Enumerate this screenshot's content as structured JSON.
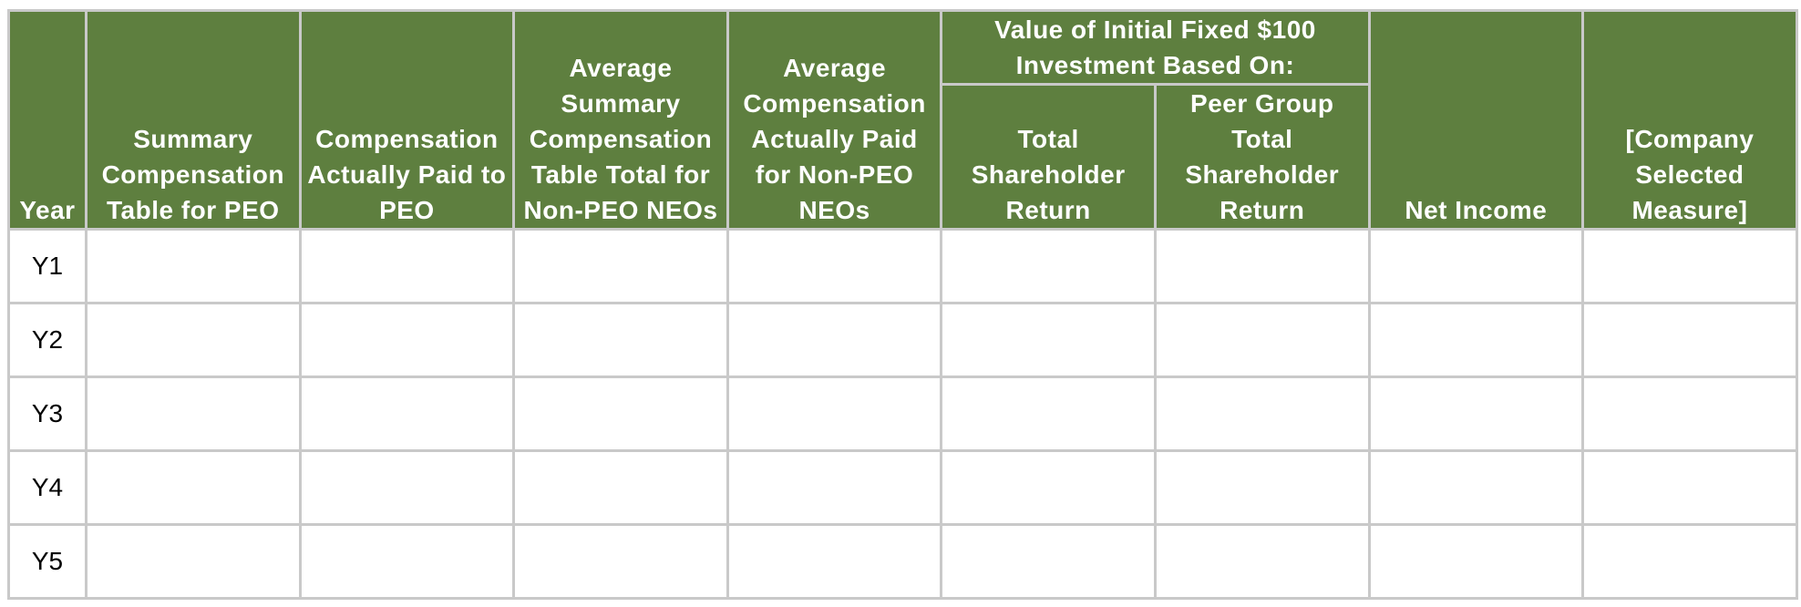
{
  "table": {
    "header_color": "#5e7f3f",
    "columns": {
      "year": "Year",
      "sct_peo": "Summary Compensation Table for PEO",
      "cap_peo": "Compensation Actually Paid to PEO",
      "avg_sct_neo": "Average Summary Compensation Table Total for Non-PEO NEOs",
      "avg_cap_neo": "Average Compensation Actually Paid for Non-PEO NEOs",
      "investment_group": "Value of Initial Fixed $100 Investment Based On:",
      "tsr": "Total Shareholder Return",
      "peer_tsr": "Peer Group Total Shareholder Return",
      "net_income": "Net Income",
      "company_measure": "[Company Selected Measure]"
    },
    "rows": [
      {
        "year": "Y1",
        "sct_peo": "",
        "cap_peo": "",
        "avg_sct_neo": "",
        "avg_cap_neo": "",
        "tsr": "",
        "peer_tsr": "",
        "net_income": "",
        "company_measure": ""
      },
      {
        "year": "Y2",
        "sct_peo": "",
        "cap_peo": "",
        "avg_sct_neo": "",
        "avg_cap_neo": "",
        "tsr": "",
        "peer_tsr": "",
        "net_income": "",
        "company_measure": ""
      },
      {
        "year": "Y3",
        "sct_peo": "",
        "cap_peo": "",
        "avg_sct_neo": "",
        "avg_cap_neo": "",
        "tsr": "",
        "peer_tsr": "",
        "net_income": "",
        "company_measure": ""
      },
      {
        "year": "Y4",
        "sct_peo": "",
        "cap_peo": "",
        "avg_sct_neo": "",
        "avg_cap_neo": "",
        "tsr": "",
        "peer_tsr": "",
        "net_income": "",
        "company_measure": ""
      },
      {
        "year": "Y5",
        "sct_peo": "",
        "cap_peo": "",
        "avg_sct_neo": "",
        "avg_cap_neo": "",
        "tsr": "",
        "peer_tsr": "",
        "net_income": "",
        "company_measure": ""
      }
    ]
  }
}
